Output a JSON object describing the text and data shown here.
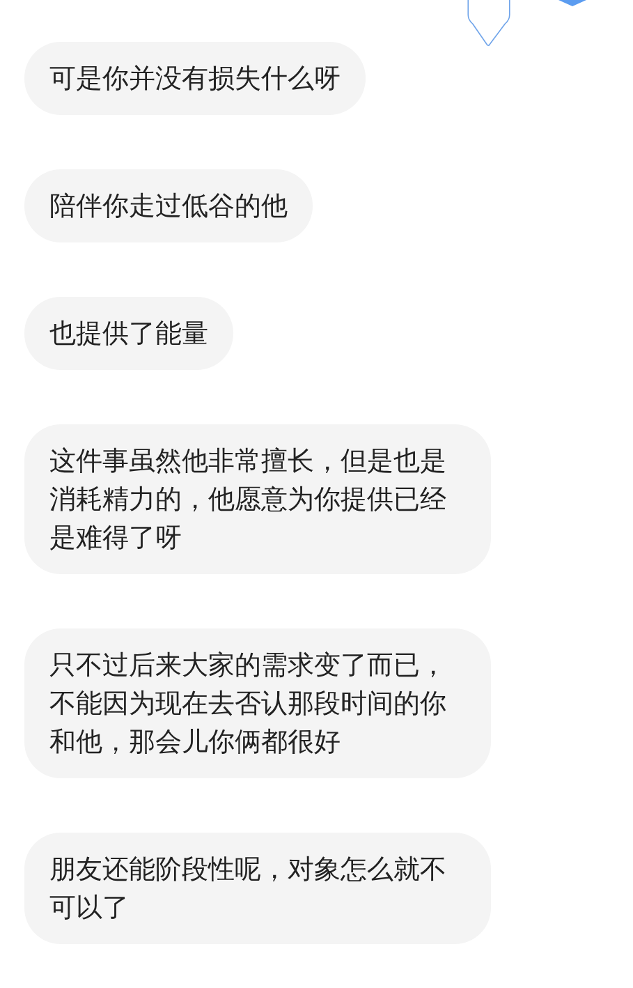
{
  "messages": [
    {
      "text": "可是你并没有损失什么呀"
    },
    {
      "text": "陪伴你走过低谷的他"
    },
    {
      "text": "也提供了能量"
    },
    {
      "text": "这件事虽然他非常擅长，但是也是消耗精力的，他愿意为你提供已经是难得了呀"
    },
    {
      "text": "只不过后来大家的需求变了而已，不能因为现在去否认那段时间的你和他，那会儿你俩都很好"
    },
    {
      "text": "朋友还能阶段性呢，对象怎么就不可以了"
    }
  ]
}
